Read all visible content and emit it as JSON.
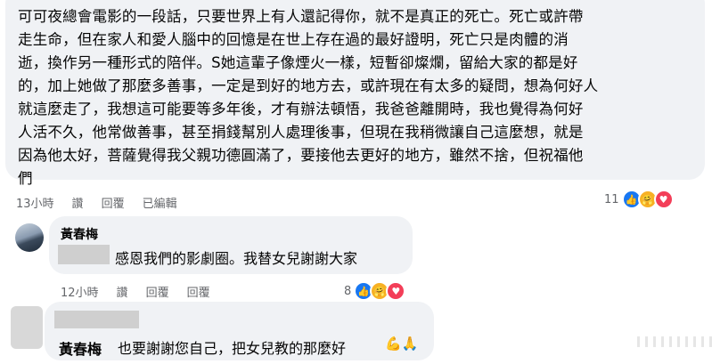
{
  "comment1": {
    "lines": [
      "可可夜總會電影的一段話，只要世界上有人還記得你，就不是真正的死亡。死亡或許帶",
      "走生命，但在家人和愛人腦中的回憶是在世上存在過的最好證明，死亡只是肉體的消",
      "逝，換作另一種形式的陪伴。S她這輩子像煙火一樣，短暫卻燦爛，留給大家的都是好",
      "的，加上她做了那麼多善事，一定是到好的地方去，或許現在有太多的疑問，想為何好人",
      "就這麼走了，我想這可能要等多年後，才有辦法頓悟，我爸爸離開時，我也覺得為何好",
      "人活不久，他常做善事，甚至捐錢幫別人處理後事，但現在我稍微讓自己這麼想，就是",
      "因為他太好，菩薩覺得我父親功德圓滿了，要接他去更好的地方，雖然不捨，但祝福他",
      "們"
    ],
    "time": "13小時",
    "like": "讚",
    "reply": "回覆",
    "edited": "已編輯",
    "reactions_count": "11"
  },
  "comment2": {
    "author": "黃春梅",
    "text": "感恩我們的影劇圈。我替女兒謝謝大家",
    "time": "12小時",
    "like": "讚",
    "reply": "回覆",
    "share": "回覆",
    "reactions_count": "8"
  },
  "comment3": {
    "author": "黃春梅",
    "text": "也要謝謝您自己，把女兒教的那麼好",
    "emoji": "💪🙏"
  }
}
